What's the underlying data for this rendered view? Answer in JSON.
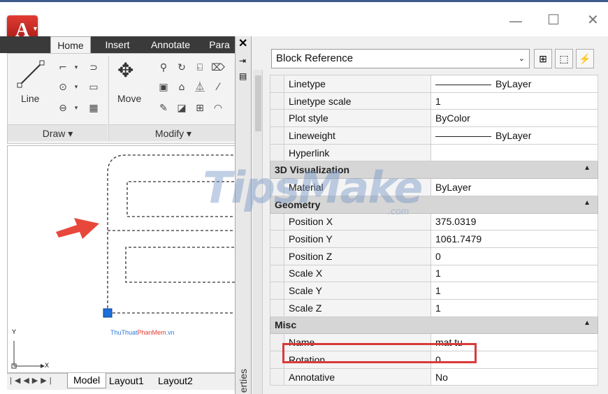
{
  "app": {
    "logo_letter": "A"
  },
  "window": {
    "minimize": "—",
    "maximize": "☐",
    "close": "✕"
  },
  "ribbon": {
    "tabs": [
      "Home",
      "Insert",
      "Annotate",
      "Para"
    ],
    "draw": {
      "line_label": "Line",
      "panel_label": "Draw ▾"
    },
    "modify": {
      "move_label": "Move",
      "panel_label": "Modify ▾"
    }
  },
  "drawing": {
    "site_label_part1": "ThuThuat",
    "site_label_part2": "PhanMem",
    "site_label_part3": ".vn",
    "axis_y": "Y",
    "axis_x": "X"
  },
  "layout_tabs": {
    "nav": [
      "|◀",
      "◀",
      "▶",
      "▶|"
    ],
    "tabs": [
      "Model",
      "Layout1",
      "Layout2"
    ]
  },
  "palette": {
    "close_icon": "✕",
    "strip_label": "erties",
    "selector": "Block Reference",
    "general_rows": [
      {
        "name": "Linetype",
        "value": "ByLayer",
        "line": true
      },
      {
        "name": "Linetype scale",
        "value": "1",
        "line": false
      },
      {
        "name": "Plot style",
        "value": "ByColor",
        "line": false
      },
      {
        "name": "Lineweight",
        "value": "ByLayer",
        "line": true
      },
      {
        "name": "Hyperlink",
        "value": "",
        "line": false
      }
    ],
    "viz_title": "3D Visualization",
    "viz_rows": [
      {
        "name": "Material",
        "value": "ByLayer"
      }
    ],
    "geometry_title": "Geometry",
    "geometry_rows": [
      {
        "name": "Position X",
        "value": "375.0319"
      },
      {
        "name": "Position Y",
        "value": "1061.7479"
      },
      {
        "name": "Position Z",
        "value": "0"
      },
      {
        "name": "Scale X",
        "value": "1"
      },
      {
        "name": "Scale Y",
        "value": "1"
      },
      {
        "name": "Scale Z",
        "value": "1"
      }
    ],
    "misc_title": "Misc",
    "misc_rows": [
      {
        "name": "Name",
        "value": "mat tu"
      },
      {
        "name": "Rotation",
        "value": "0"
      },
      {
        "name": "Annotative",
        "value": "No"
      }
    ]
  },
  "watermark": {
    "text": "TipsMake",
    "suffix": ".com"
  },
  "colors": {
    "accent_red": "#d93a3a",
    "selected_grip": "#1e6fd9",
    "arrow": "#e8483c"
  }
}
